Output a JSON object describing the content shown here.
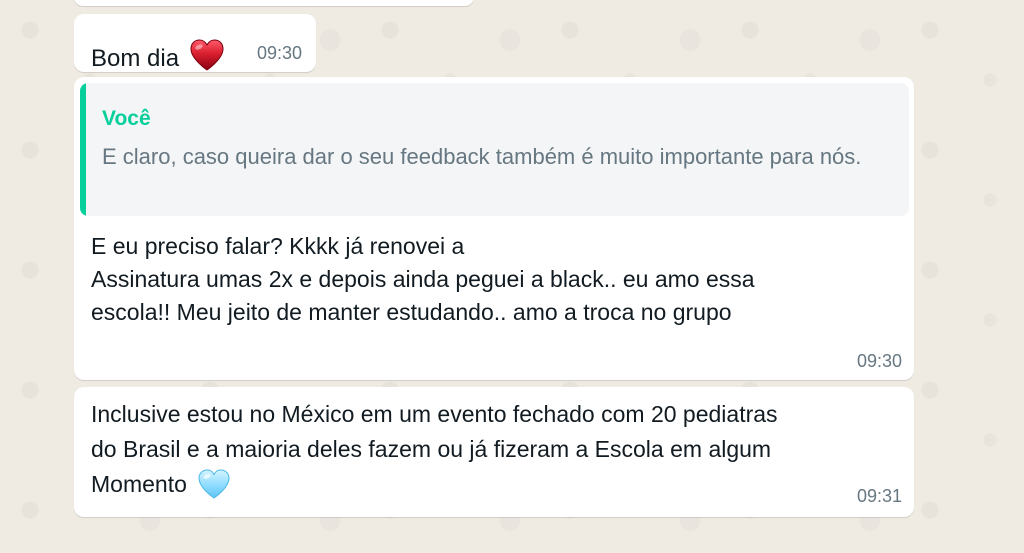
{
  "messages": [
    {
      "text": "Bom dia",
      "emoji": "red-heart-icon",
      "time": "09:30"
    },
    {
      "quote": {
        "author": "Você",
        "text": "E claro, caso queira dar o seu feedback também é muito importante para nós."
      },
      "lines": [
        "E eu preciso falar? Kkkk já renovei a",
        "Assinatura umas 2x e depois ainda peguei a black.. eu amo essa",
        "escola!! Meu jeito de manter estudando.. amo a troca no grupo"
      ],
      "time": "09:30"
    },
    {
      "lines": [
        "Inclusive estou no México em um evento fechado com 20 pediatras",
        "do Brasil e a maioria deles fazem ou já fizeram a Escola em algum",
        "Momento"
      ],
      "emoji": "blue-heart-icon",
      "time": "09:31"
    }
  ],
  "colors": {
    "background": "#efeae2",
    "bubble": "#ffffff",
    "quote_accent": "#06cf9c",
    "meta_text": "#667781"
  }
}
